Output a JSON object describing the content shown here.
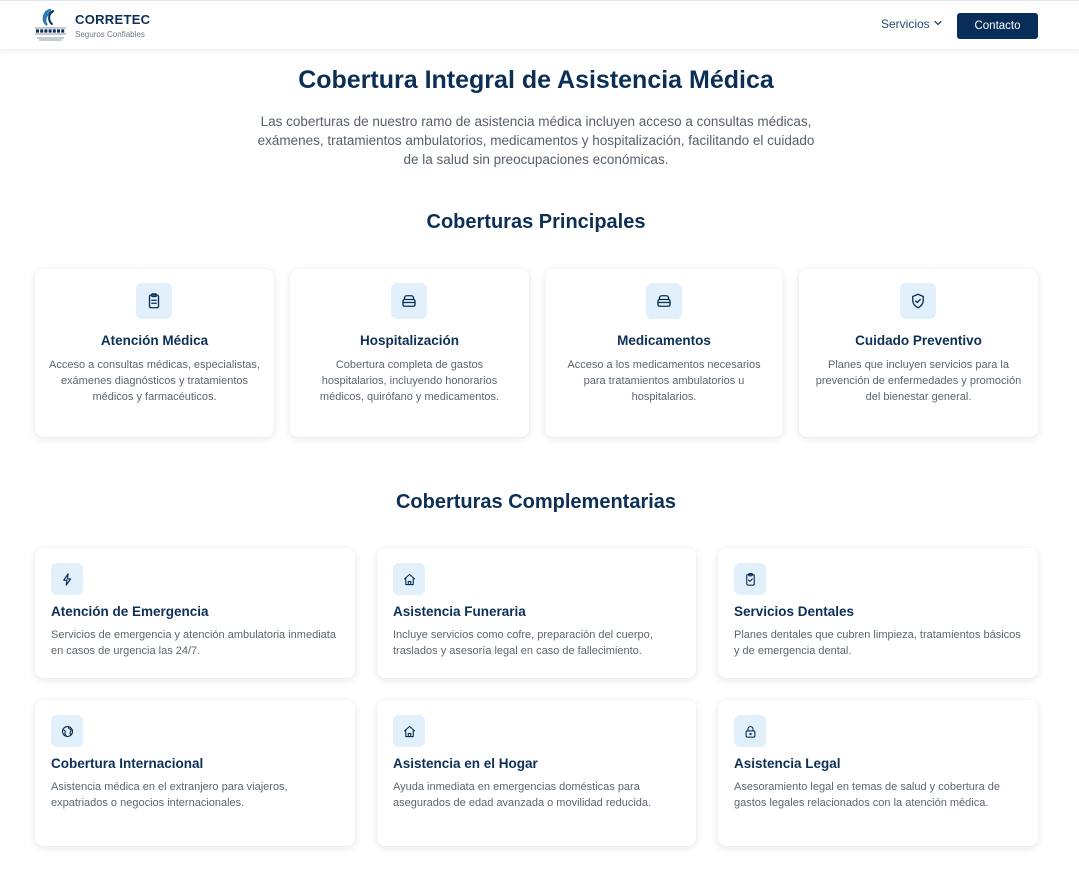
{
  "header": {
    "brand_name": "CORRETEC",
    "brand_tagline": "Seguros Confiables",
    "nav_services": "Servicios",
    "contact_button": "Contacto"
  },
  "hero": {
    "title": "Cobertura Integral de Asistencia Médica",
    "description": "Las coberturas de nuestro ramo de asistencia médica incluyen acceso a consultas médicas, exámenes, tratamientos ambulatorios, medicamentos y hospitalización, facilitando el cuidado de la salud sin preocupaciones económicas."
  },
  "main_section": {
    "title": "Coberturas Principales",
    "cards": [
      {
        "icon": "clipboard-icon",
        "title": "Atención Médica",
        "text": "Acceso a consultas médicas, especialistas, exámenes diagnósticos y tratamientos médicos y farmacéuticos."
      },
      {
        "icon": "bed-icon",
        "title": "Hospitalización",
        "text": "Cobertura completa de gastos hospitalarios, incluyendo honorarios médicos, quirófano y medicamentos."
      },
      {
        "icon": "medicine-box-icon",
        "title": "Medicamentos",
        "text": "Acceso a los medicamentos necesarios para tratamientos ambulatorios u hospitalarios."
      },
      {
        "icon": "shield-check-icon",
        "title": "Cuidado Preventivo",
        "text": "Planes que incluyen servicios para la prevención de enfermedades y promoción del bienestar general."
      }
    ]
  },
  "complementary_section": {
    "title": "Coberturas Complementarias",
    "cards": [
      {
        "icon": "lightning-icon",
        "title": "Atención de Emergencia",
        "text": "Servicios de emergencia y atención ambulatoria inmediata en casos de urgencia las 24/7."
      },
      {
        "icon": "home-icon",
        "title": "Asistencia Funeraria",
        "text": "Incluye servicios como cofre, preparación del cuerpo, traslados y asesoría legal en caso de fallecimiento."
      },
      {
        "icon": "clipboard-check-icon",
        "title": "Servicios Dentales",
        "text": "Planes dentales que cubren limpieza, tratamientos básicos y de emergencia dental."
      },
      {
        "icon": "globe-icon",
        "title": "Cobertura Internacional",
        "text": "Asistencia médica en el extranjero para viajeros, expatriados o negocios internacionales."
      },
      {
        "icon": "home-icon",
        "title": "Asistencia en el Hogar",
        "text": "Ayuda inmediata en emergencias domésticas para asegurados de edad avanzada o movilidad reducida."
      },
      {
        "icon": "lock-icon",
        "title": "Asistencia Legal",
        "text": "Asesoramiento legal en temas de salud y cobertura de gastos legales relacionados con la atención médica."
      }
    ]
  },
  "colors": {
    "primary": "#0c2f55",
    "button": "#082d59",
    "icon_bg": "#e1f0fb",
    "body_text": "#5b6570"
  }
}
